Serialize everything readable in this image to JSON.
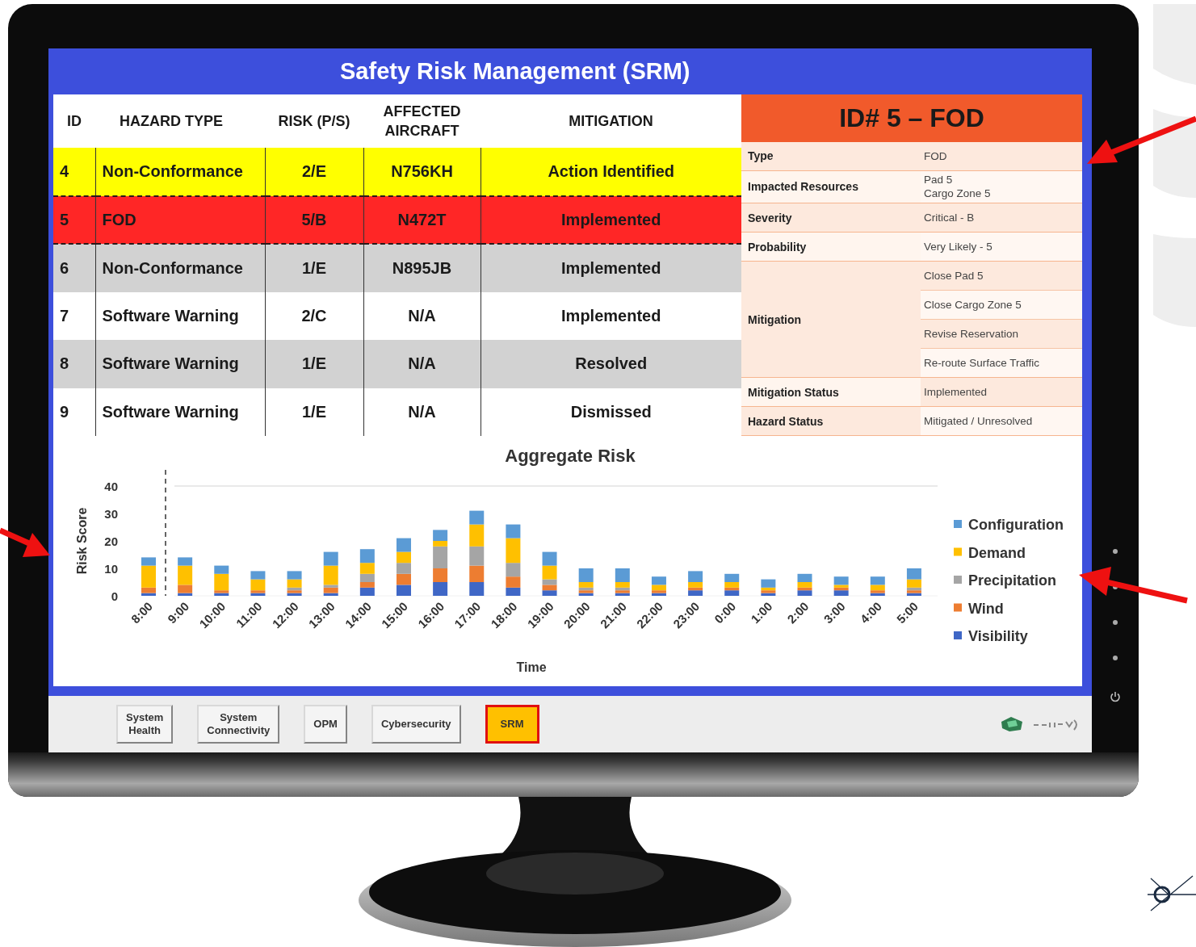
{
  "screen": {
    "title": "Safety Risk Management (SRM)"
  },
  "table": {
    "columns": [
      "ID",
      "HAZARD TYPE",
      "RISK (P/S)",
      "AFFECTED AIRCRAFT",
      "MITIGATION"
    ],
    "rows": [
      {
        "cells": [
          "4",
          "Non-Conformance",
          "2/E",
          "N756KH",
          "Action Identified"
        ],
        "color": "#ffff00",
        "selected": false
      },
      {
        "cells": [
          "5",
          "FOD",
          "5/B",
          "N472T",
          "Implemented"
        ],
        "color": "#ff2626",
        "selected": true
      },
      {
        "cells": [
          "6",
          "Non-Conformance",
          "1/E",
          "N895JB",
          "Implemented"
        ],
        "color": "#d2d2d2",
        "selected": false
      },
      {
        "cells": [
          "7",
          "Software Warning",
          "2/C",
          "N/A",
          "Implemented"
        ],
        "color": "#ffffff",
        "selected": false
      },
      {
        "cells": [
          "8",
          "Software Warning",
          "1/E",
          "N/A",
          "Resolved"
        ],
        "color": "#d2d2d2",
        "selected": false
      },
      {
        "cells": [
          "9",
          "Software Warning",
          "1/E",
          "N/A",
          "Dismissed"
        ],
        "color": "#ffffff",
        "selected": false
      }
    ]
  },
  "detail": {
    "title": "ID# 5 – FOD",
    "fields": [
      {
        "label": "Type",
        "values": [
          "FOD"
        ]
      },
      {
        "label": "Impacted Resources",
        "values": [
          "Pad 5\nCargo Zone 5"
        ]
      },
      {
        "label": "Severity",
        "values": [
          "Critical - B"
        ]
      },
      {
        "label": "Probability",
        "values": [
          "Very Likely - 5"
        ]
      },
      {
        "label": "Mitigation",
        "values": [
          "Close Pad 5",
          "Close Cargo Zone 5",
          "Revise Reservation",
          "Re-route Surface Traffic"
        ]
      },
      {
        "label": "Mitigation Status",
        "values": [
          "Implemented"
        ]
      },
      {
        "label": "Hazard Status",
        "values": [
          "Mitigated / Unresolved"
        ]
      }
    ]
  },
  "chart": {
    "chart_data": {
      "type": "bar",
      "title": "Aggregate Risk",
      "xlabel": "Time",
      "ylabel": "Risk Score",
      "stacked": true,
      "categories": [
        "8:00",
        "9:00",
        "10:00",
        "11:00",
        "12:00",
        "13:00",
        "14:00",
        "15:00",
        "16:00",
        "17:00",
        "18:00",
        "19:00",
        "20:00",
        "21:00",
        "22:00",
        "23:00",
        "0:00",
        "1:00",
        "2:00",
        "3:00",
        "4:00",
        "5:00"
      ],
      "series": [
        {
          "name": "Visibility",
          "color": "#3f67c6",
          "values": [
            1,
            1,
            1,
            1,
            1,
            1,
            3,
            4,
            5,
            5,
            3,
            2,
            1,
            1,
            1,
            2,
            2,
            1,
            2,
            2,
            1,
            1
          ]
        },
        {
          "name": "Wind",
          "color": "#ed7d31",
          "values": [
            2,
            3,
            1,
            1,
            1,
            2,
            2,
            4,
            5,
            6,
            4,
            2,
            1,
            1,
            1,
            1,
            1,
            1,
            1,
            1,
            1,
            1
          ]
        },
        {
          "name": "Precipitation",
          "color": "#a5a5a5",
          "values": [
            0,
            0,
            0,
            0,
            1,
            1,
            3,
            4,
            8,
            7,
            5,
            2,
            1,
            1,
            0,
            0,
            0,
            0,
            0,
            0,
            0,
            1
          ]
        },
        {
          "name": "Demand",
          "color": "#ffc000",
          "values": [
            8,
            7,
            6,
            4,
            3,
            7,
            4,
            4,
            2,
            8,
            9,
            5,
            2,
            2,
            2,
            2,
            2,
            1,
            2,
            1,
            2,
            3
          ]
        },
        {
          "name": "Configuration",
          "color": "#5b9bd5",
          "values": [
            3,
            3,
            3,
            3,
            3,
            5,
            5,
            5,
            4,
            5,
            5,
            5,
            5,
            5,
            3,
            4,
            3,
            3,
            3,
            3,
            3,
            4
          ]
        }
      ],
      "ylim": [
        0,
        40
      ],
      "yticks": [
        0,
        10,
        20,
        30,
        40
      ],
      "legend": "right"
    }
  },
  "taskbar": {
    "buttons": [
      {
        "label": "System\nHealth",
        "selected": false
      },
      {
        "label": "System\nConnectivity",
        "selected": false
      },
      {
        "label": "OPM",
        "selected": false
      },
      {
        "label": "Cybersecurity",
        "selected": false
      },
      {
        "label": "SRM",
        "selected": true
      }
    ]
  }
}
